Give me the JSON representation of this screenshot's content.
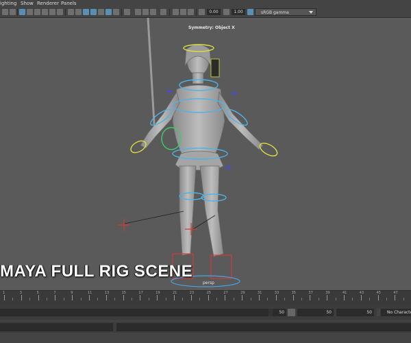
{
  "menubar": {
    "items": [
      "Lighting",
      "Show",
      "Renderer",
      "Panels"
    ]
  },
  "toolbar": {
    "exposure_value": "0.00",
    "gamma_value": "1.00",
    "color_space": "sRGB gamma"
  },
  "viewport": {
    "symmetry_label": "Symmetry: Object X",
    "camera_label": "persp",
    "overlay_title": "MAYA FULL RIG SCENE"
  },
  "timeline": {
    "tick_labels": [
      "1",
      "3",
      "5",
      "7",
      "9",
      "11",
      "13",
      "15",
      "17",
      "19",
      "21",
      "23",
      "25",
      "27",
      "29",
      "31",
      "33",
      "35",
      "37",
      "39",
      "41",
      "43",
      "45",
      "47"
    ]
  },
  "range": {
    "start_field": "50",
    "end_field": "50",
    "end_field_2": "50",
    "character_set": "No Character Set"
  }
}
